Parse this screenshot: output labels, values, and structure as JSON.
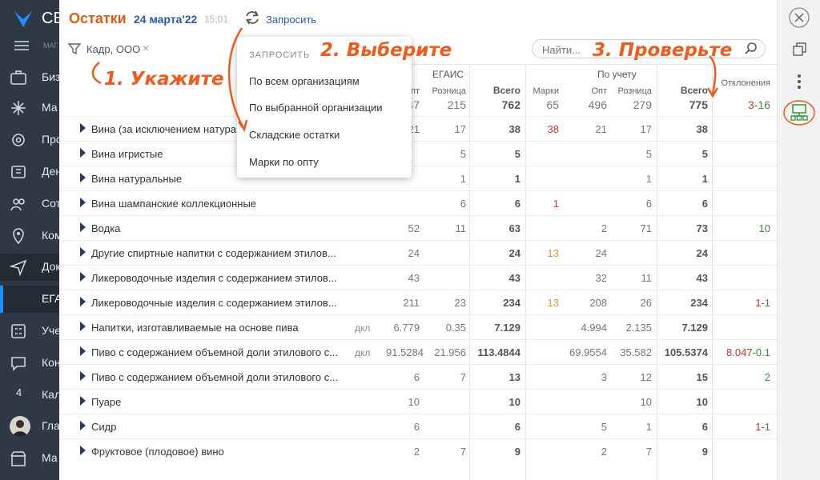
{
  "sidebar": {
    "brand": "СБ",
    "section": "МАГ",
    "items": [
      {
        "label": "Биз"
      },
      {
        "label": "Ма"
      },
      {
        "label": "Про"
      },
      {
        "label": "Ден"
      },
      {
        "label": "Сот"
      },
      {
        "label": "Ком"
      },
      {
        "label": "Док"
      },
      {
        "label": "ЕГА"
      },
      {
        "label": "Уче"
      },
      {
        "label": "Кон"
      },
      {
        "label": "Кал",
        "badge": "4"
      },
      {
        "label": "Гла"
      },
      {
        "label": "Ма"
      }
    ]
  },
  "header": {
    "title": "Остатки",
    "date": "24 марта'22",
    "time": "15:01",
    "request_label": "Запросить"
  },
  "filter": {
    "value": "Кадр, ООО",
    "clear": "×"
  },
  "search": {
    "placeholder": "Найти..."
  },
  "table": {
    "groups": {
      "egais": "ЕГАИС",
      "accounting": "По учету",
      "deviation": "Отклонения"
    },
    "columns": {
      "egais_opt": "Опт",
      "egais_retail": "Розница",
      "egais_total": "Всего",
      "marks": "Марки",
      "acc_opt": "Опт",
      "acc_retail": "Розница",
      "acc_total": "Всего"
    },
    "totals": {
      "egais_opt": "547",
      "egais_retail": "215",
      "egais_total": "762",
      "marks": "65",
      "acc_opt": "496",
      "acc_retail": "279",
      "acc_total": "775",
      "dev_red": "3",
      "dev_green": "-16"
    },
    "rows": [
      {
        "name": "Вина (за исключением натура...",
        "unit": "",
        "eo": "21",
        "er": "17",
        "et": "38",
        "m": "38",
        "ao": "21",
        "ar": "17",
        "at": "38",
        "dr": "",
        "dg": ""
      },
      {
        "name": "Вина игристые",
        "unit": "",
        "eo": "",
        "er": "5",
        "et": "5",
        "m": "",
        "ao": "",
        "ar": "5",
        "at": "5",
        "dr": "",
        "dg": ""
      },
      {
        "name": "Вина натуральные",
        "unit": "",
        "eo": "",
        "er": "1",
        "et": "1",
        "m": "",
        "ao": "",
        "ar": "1",
        "at": "1",
        "dr": "",
        "dg": ""
      },
      {
        "name": "Вина шампанские коллекционные",
        "unit": "",
        "eo": "",
        "er": "6",
        "et": "6",
        "m": "1",
        "ao": "",
        "ar": "6",
        "at": "6",
        "dr": "",
        "dg": ""
      },
      {
        "name": "Водка",
        "unit": "",
        "eo": "52",
        "er": "11",
        "et": "63",
        "m": "",
        "ao": "2",
        "ar": "71",
        "at": "73",
        "dr": "",
        "dg": "10"
      },
      {
        "name": "Другие спиртные напитки с содержанием этилов...",
        "unit": "",
        "eo": "24",
        "er": "",
        "et": "24",
        "m": "13",
        "ao": "24",
        "ar": "",
        "at": "24",
        "dr": "",
        "dg": ""
      },
      {
        "name": "Ликероводочные изделия с содержанием этилов...",
        "unit": "",
        "eo": "43",
        "er": "",
        "et": "43",
        "m": "",
        "ao": "32",
        "ar": "11",
        "at": "43",
        "dr": "",
        "dg": ""
      },
      {
        "name": "Ликероводочные изделия с содержанием этилов...",
        "unit": "",
        "eo": "211",
        "er": "23",
        "et": "234",
        "m": "13",
        "ao": "208",
        "ar": "26",
        "at": "234",
        "dr": "1",
        "dg": "-1"
      },
      {
        "name": "Напитки, изготавливаемые на основе пива",
        "unit": "дкл",
        "eo": "6.779",
        "er": "0.35",
        "et": "7.129",
        "m": "",
        "ao": "4.994",
        "ar": "2.135",
        "at": "7.129",
        "dr": "",
        "dg": ""
      },
      {
        "name": "Пиво с содержанием объемной доли этилового с...",
        "unit": "дкл",
        "eo": "91.5284",
        "er": "21.956",
        "et": "113.4844",
        "m": "",
        "ao": "69.9554",
        "ar": "35.582",
        "at": "105.5374",
        "dr": "8.047",
        "dg": "-0.1"
      },
      {
        "name": "Пиво с содержанием объемной доли этилового с...",
        "unit": "",
        "eo": "6",
        "er": "7",
        "et": "13",
        "m": "",
        "ao": "3",
        "ar": "12",
        "at": "15",
        "dr": "",
        "dg": "2"
      },
      {
        "name": "Пуаре",
        "unit": "",
        "eo": "10",
        "er": "",
        "et": "10",
        "m": "",
        "ao": "",
        "ar": "10",
        "at": "10",
        "dr": "",
        "dg": ""
      },
      {
        "name": "Сидр",
        "unit": "",
        "eo": "6",
        "er": "",
        "et": "6",
        "m": "",
        "ao": "5",
        "ar": "1",
        "at": "6",
        "dr": "1",
        "dg": "-1"
      },
      {
        "name": "Фруктовое (плодовое) вино",
        "unit": "",
        "eo": "2",
        "er": "7",
        "et": "9",
        "m": "",
        "ao": "2",
        "ar": "7",
        "at": "9",
        "dr": "",
        "dg": ""
      }
    ]
  },
  "dropdown": {
    "title": "ЗАПРОСИТЬ",
    "items": [
      "По всем организациям",
      "По выбранной организации",
      "Складские остатки",
      "Марки по опту"
    ]
  },
  "annotations": {
    "step1": "1. Укажите",
    "step2": "2. Выберите",
    "step3": "3. Проверьте"
  },
  "colors": {
    "accent": "#e05a13",
    "link": "#2b5aa5",
    "sidebar": "#2f3845",
    "annotation": "#f05a1a"
  }
}
